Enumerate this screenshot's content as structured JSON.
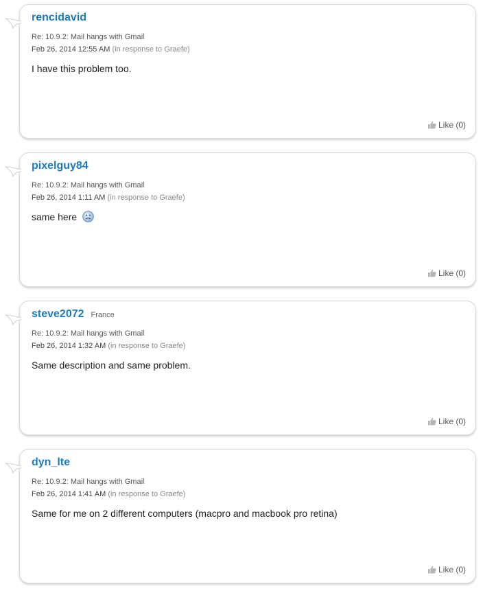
{
  "posts": [
    {
      "author": "rencidavid",
      "location": "",
      "subject": "Re: 10.9.2: Mail hangs with Gmail",
      "date": "Feb 26, 2014 12:55 AM",
      "response_prefix": "(in response to ",
      "response_to": "Graefe",
      "response_suffix": ")",
      "message": "I have this problem too.",
      "has_emoji": false,
      "like_label": "Like (0)"
    },
    {
      "author": "pixelguy84",
      "location": "",
      "subject": "Re: 10.9.2: Mail hangs with Gmail",
      "date": "Feb 26, 2014 1:11 AM",
      "response_prefix": "(in response to ",
      "response_to": "Graefe",
      "response_suffix": ")",
      "message": "same here",
      "has_emoji": true,
      "like_label": "Like (0)"
    },
    {
      "author": "steve2072",
      "location": "France",
      "subject": "Re: 10.9.2: Mail hangs with Gmail",
      "date": "Feb 26, 2014 1:32 AM",
      "response_prefix": "(in response to ",
      "response_to": "Graefe",
      "response_suffix": ")",
      "message": "Same description and same problem.",
      "has_emoji": false,
      "like_label": "Like (0)"
    },
    {
      "author": "dyn_lte",
      "location": "",
      "subject": "Re: 10.9.2: Mail hangs with Gmail",
      "date": "Feb 26, 2014 1:41 AM",
      "response_prefix": "(in response to ",
      "response_to": "Graefe",
      "response_suffix": ")",
      "message": "Same for me on 2 different computers (macpro and macbook pro retina)",
      "has_emoji": false,
      "like_label": "Like (0)"
    }
  ],
  "colors": {
    "author_link": "#1a7bbf",
    "meta_text": "#555555",
    "card_border": "#d9d9d9"
  },
  "icons": {
    "like": "thumbs-up-icon",
    "emoji": "frown-emoji-icon"
  }
}
